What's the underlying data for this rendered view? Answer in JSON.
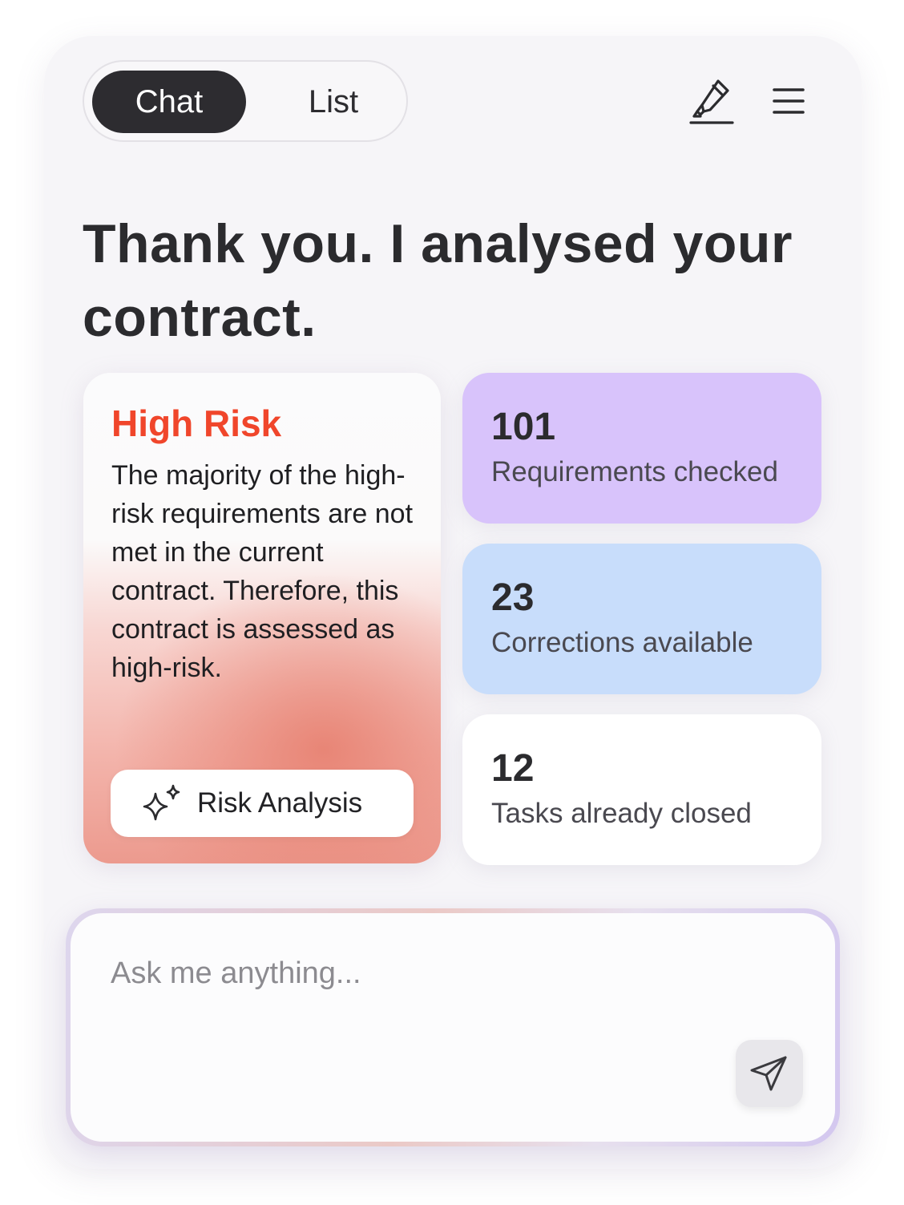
{
  "tabs": {
    "chat_label": "Chat",
    "list_label": "List",
    "active": "Chat"
  },
  "header": {
    "icons": [
      "highlighter-icon",
      "menu-icon"
    ]
  },
  "title": "Thank you. I analysed your contract.",
  "risk_card": {
    "heading": "High Risk",
    "description": "The majority of the high-risk requirements are not met in the current contract. Therefore, this contract is assessed as high-risk.",
    "button_label": "Risk Analysis",
    "button_icon": "sparkle-icon",
    "accent_color": "#f0462b"
  },
  "stats": [
    {
      "value": "101",
      "label": "Requirements checked",
      "color": "#d8c3fb"
    },
    {
      "value": "23",
      "label": "Corrections available",
      "color": "#c8ddfb"
    },
    {
      "value": "12",
      "label": "Tasks already closed",
      "color": "#ffffff"
    }
  ],
  "chat_input": {
    "placeholder": "Ask me anything...",
    "value": "",
    "send_icon": "send-icon"
  }
}
